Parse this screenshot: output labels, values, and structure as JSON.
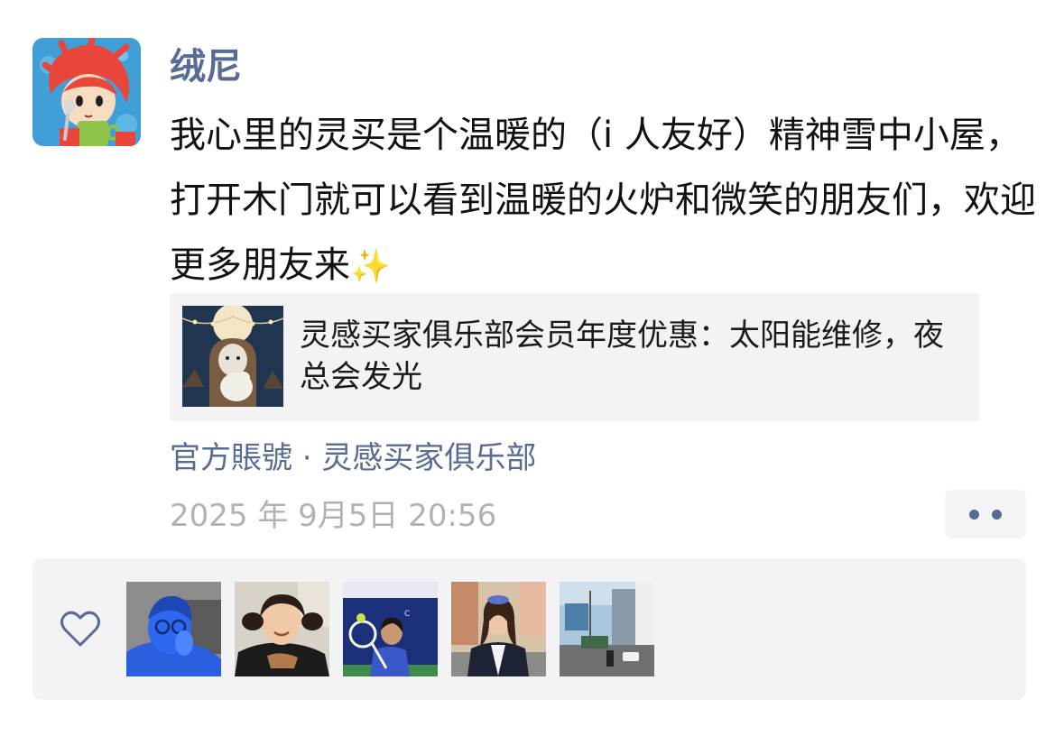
{
  "post": {
    "author": "绒尼",
    "text": "我心里的灵买是个温暖的（i 人友好）精神雪中小屋，打开木门就可以看到温暖的火炉和微笑的朋友们，欢迎更多朋友来",
    "emoji": "✨",
    "link": {
      "title": "灵感买家俱乐部会员年度优惠：太阳能维修，夜总会发光"
    },
    "source": "官方賬號 · 灵感买家俱乐部",
    "timestamp": "2025 年 9月5日 20:56"
  },
  "icons": {
    "more": "more-dots-icon",
    "like": "heart-outline-icon"
  },
  "colors": {
    "link_blue": "#576b95",
    "text": "#111111",
    "muted": "#b2b2b2",
    "panel": "#f3f3f5"
  },
  "likes": {
    "count_shown": 5
  }
}
